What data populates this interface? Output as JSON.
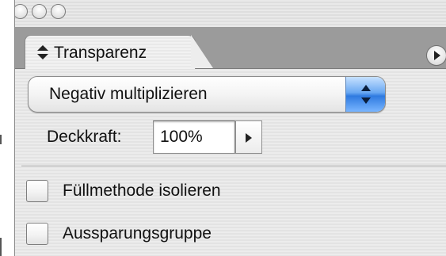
{
  "window": {
    "controls": [
      "close-button",
      "minimize-button",
      "zoom-button"
    ]
  },
  "panel": {
    "tab_label": "Transparenz",
    "tab_icon": "up-down-arrows-icon",
    "menu_icon": "panel-menu-arrow-icon"
  },
  "blend_mode": {
    "selected": "Negativ multiplizieren",
    "accent_color": "#3d86e6"
  },
  "opacity": {
    "label": "Deckkraft:",
    "value": "100%"
  },
  "options": {
    "isolate_blending": {
      "label": "Füllmethode isolieren",
      "checked": false
    },
    "knockout_group": {
      "label": "Aussparungsgruppe",
      "checked": false
    }
  }
}
